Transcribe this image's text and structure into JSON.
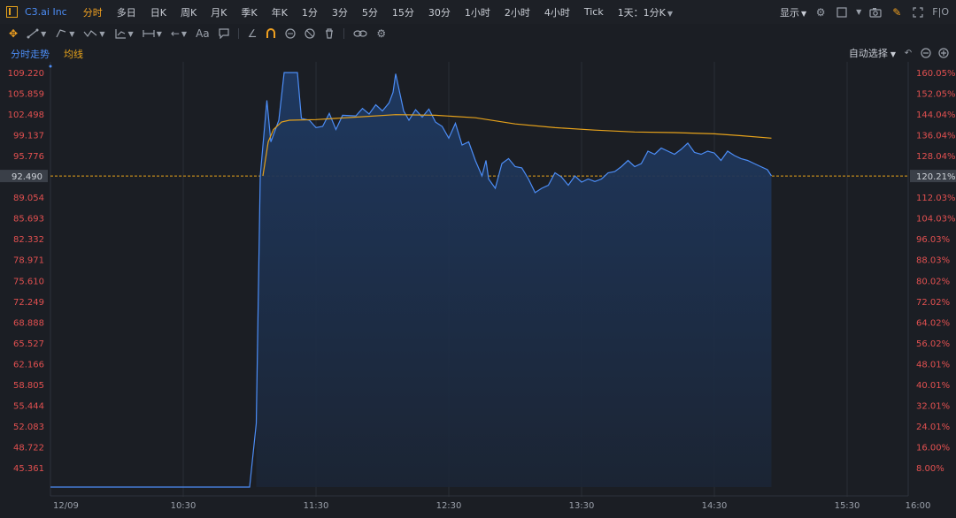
{
  "header": {
    "ticker": "C3.ai Inc",
    "tabs": [
      "分时",
      "多日",
      "日K",
      "周K",
      "月K",
      "季K",
      "年K",
      "1分",
      "3分",
      "5分",
      "15分",
      "30分",
      "1小时",
      "2小时",
      "4小时",
      "Tick"
    ],
    "active_tab": "分时",
    "period_select": "1天：1分K",
    "display_label": "显示",
    "fio_label": "F|O"
  },
  "toolbar": {
    "text_tool": "Aa"
  },
  "legend": {
    "series1": "分时走势",
    "series2": "均线"
  },
  "auto_select": "自动选择",
  "colors": {
    "price_line": "#4c8df6",
    "avg_line": "#e6a21b",
    "axis_text": "#e25050",
    "grid": "#2a2e36",
    "fill_top": "#1f3a63"
  },
  "chart_data": {
    "type": "area",
    "ylim": [
      45.361,
      109.22
    ],
    "y_left_ticks": [
      "109.220",
      "105.859",
      "102.498",
      "99.137",
      "95.776",
      "92.490",
      "89.054",
      "85.693",
      "82.332",
      "78.971",
      "75.610",
      "72.249",
      "68.888",
      "65.527",
      "62.166",
      "58.805",
      "55.444",
      "52.083",
      "48.722",
      "45.361"
    ],
    "y_right_ticks": [
      "160.05%",
      "152.05%",
      "144.04%",
      "136.04%",
      "128.04%",
      "120.21%",
      "112.03%",
      "104.03%",
      "96.03%",
      "88.03%",
      "80.02%",
      "72.02%",
      "64.02%",
      "56.02%",
      "48.01%",
      "40.01%",
      "32.01%",
      "24.01%",
      "16.00%",
      "8.00%"
    ],
    "x_ticks": [
      "12/09",
      "10:30",
      "11:30",
      "12:30",
      "13:30",
      "14:30",
      "15:30",
      "16:00"
    ],
    "ref_price": "92.490",
    "series": [
      {
        "name": "分时走势",
        "values": [
          [
            0,
            41.7
          ],
          [
            1,
            41.7
          ],
          [
            1.5,
            41.7
          ],
          [
            1.55,
            52.5
          ],
          [
            1.58,
            92.5
          ],
          [
            1.63,
            104.7
          ],
          [
            1.66,
            98.0
          ],
          [
            1.72,
            101.5
          ],
          [
            1.76,
            109.2
          ],
          [
            1.86,
            109.2
          ],
          [
            1.89,
            101.8
          ],
          [
            1.95,
            101.5
          ],
          [
            2.0,
            100.3
          ],
          [
            2.05,
            100.5
          ],
          [
            2.1,
            102.6
          ],
          [
            2.15,
            100.0
          ],
          [
            2.2,
            102.3
          ],
          [
            2.3,
            102.2
          ],
          [
            2.35,
            103.4
          ],
          [
            2.4,
            102.5
          ],
          [
            2.45,
            104.0
          ],
          [
            2.5,
            103.0
          ],
          [
            2.55,
            104.3
          ],
          [
            2.58,
            106.0
          ],
          [
            2.6,
            109.0
          ],
          [
            2.63,
            106.0
          ],
          [
            2.66,
            103.0
          ],
          [
            2.7,
            101.5
          ],
          [
            2.75,
            103.2
          ],
          [
            2.8,
            102.0
          ],
          [
            2.85,
            103.3
          ],
          [
            2.9,
            101.2
          ],
          [
            2.95,
            100.5
          ],
          [
            3.0,
            98.6
          ],
          [
            3.05,
            101.0
          ],
          [
            3.1,
            97.5
          ],
          [
            3.15,
            98.0
          ],
          [
            3.2,
            95.0
          ],
          [
            3.25,
            92.5
          ],
          [
            3.28,
            95.0
          ],
          [
            3.3,
            92.0
          ],
          [
            3.35,
            90.5
          ],
          [
            3.4,
            94.5
          ],
          [
            3.45,
            95.3
          ],
          [
            3.5,
            94.0
          ],
          [
            3.55,
            93.8
          ],
          [
            3.6,
            92.0
          ],
          [
            3.65,
            89.8
          ],
          [
            3.7,
            90.5
          ],
          [
            3.75,
            91.0
          ],
          [
            3.8,
            93.0
          ],
          [
            3.85,
            92.3
          ],
          [
            3.9,
            91.0
          ],
          [
            3.95,
            92.5
          ],
          [
            4.0,
            91.5
          ],
          [
            4.05,
            92.0
          ],
          [
            4.1,
            91.6
          ],
          [
            4.15,
            92.0
          ],
          [
            4.2,
            93.0
          ],
          [
            4.25,
            93.2
          ],
          [
            4.3,
            94.0
          ],
          [
            4.35,
            95.0
          ],
          [
            4.4,
            94.0
          ],
          [
            4.45,
            94.5
          ],
          [
            4.5,
            96.5
          ],
          [
            4.55,
            96.0
          ],
          [
            4.6,
            97.0
          ],
          [
            4.65,
            96.5
          ],
          [
            4.7,
            96.0
          ],
          [
            4.75,
            96.8
          ],
          [
            4.8,
            97.8
          ],
          [
            4.85,
            96.3
          ],
          [
            4.9,
            96.0
          ],
          [
            4.95,
            96.5
          ],
          [
            5.0,
            96.2
          ],
          [
            5.05,
            95.0
          ],
          [
            5.1,
            96.5
          ],
          [
            5.15,
            95.8
          ],
          [
            5.2,
            95.3
          ],
          [
            5.25,
            95.0
          ],
          [
            5.3,
            94.5
          ],
          [
            5.35,
            94.0
          ],
          [
            5.4,
            93.5
          ],
          [
            5.43,
            92.5
          ]
        ]
      },
      {
        "name": "均线",
        "values": [
          [
            1.6,
            92.5
          ],
          [
            1.64,
            98.0
          ],
          [
            1.68,
            100.0
          ],
          [
            1.74,
            101.2
          ],
          [
            1.8,
            101.5
          ],
          [
            2.0,
            101.6
          ],
          [
            2.3,
            102.0
          ],
          [
            2.6,
            102.4
          ],
          [
            2.9,
            102.3
          ],
          [
            3.2,
            101.9
          ],
          [
            3.5,
            100.9
          ],
          [
            3.8,
            100.3
          ],
          [
            4.1,
            99.9
          ],
          [
            4.4,
            99.6
          ],
          [
            4.7,
            99.5
          ],
          [
            5.0,
            99.3
          ],
          [
            5.2,
            99.0
          ],
          [
            5.43,
            98.6
          ]
        ]
      }
    ]
  }
}
